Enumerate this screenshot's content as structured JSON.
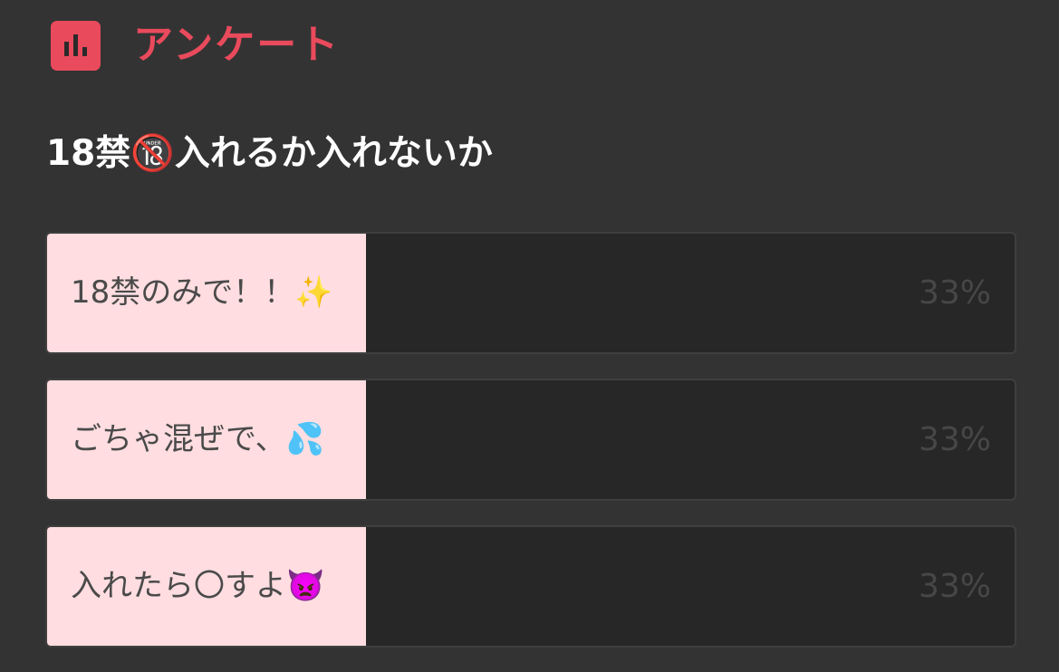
{
  "header": {
    "icon": "bar-chart-icon",
    "title": "アンケート",
    "accent_color": "#e94a5c"
  },
  "question": "18禁🔞入れるか入れないか",
  "options": [
    {
      "label": "18禁のみで！！✨",
      "percent_text": "33%",
      "share": 0.33
    },
    {
      "label": "ごちゃ混ぜで、💦",
      "percent_text": "33%",
      "share": 0.33
    },
    {
      "label": "入れたら〇すよ👿",
      "percent_text": "33%",
      "share": 0.33
    }
  ],
  "colors": {
    "background": "#333333",
    "bar_fill": "#ffdde0",
    "bar_track": "#272727"
  }
}
